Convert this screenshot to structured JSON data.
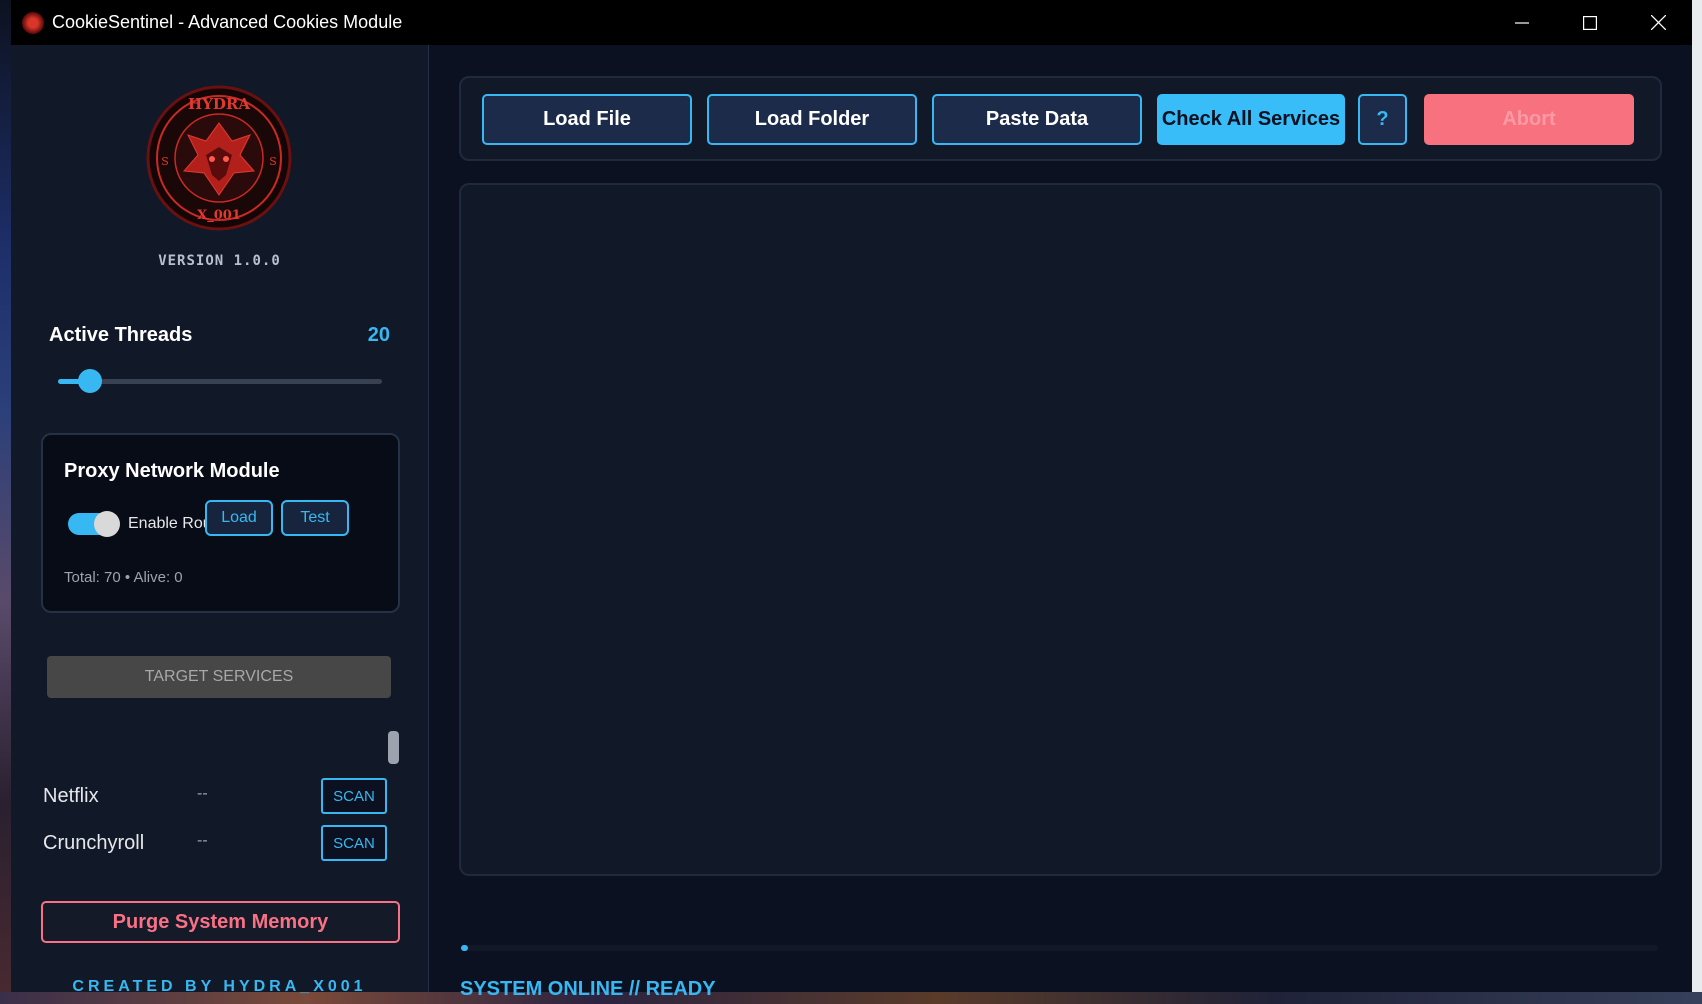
{
  "window": {
    "title": "CookieSentinel - Advanced Cookies Module"
  },
  "sidebar": {
    "logo": {
      "top_text": "HYDRA",
      "bottom_text": "X_001",
      "side_letter": "S"
    },
    "version": "VERSION 1.0.0",
    "threads": {
      "label": "Active Threads",
      "value": "20",
      "slider_fraction": 0.1
    },
    "proxy": {
      "title": "Proxy Network Module",
      "toggle_label": "Enable Route",
      "toggle_on": true,
      "load_label": "Load",
      "test_label": "Test",
      "stats": "Total: 70  •  Alive: 0"
    },
    "services": {
      "header": "TARGET SERVICES",
      "items": [
        {
          "name": "Netflix",
          "status": "--",
          "action": "SCAN"
        },
        {
          "name": "Crunchyroll",
          "status": "--",
          "action": "SCAN"
        }
      ]
    },
    "purge_label": "Purge System Memory",
    "credit": "CREATED BY HYDRA_X001"
  },
  "toolbar": {
    "load_file": "Load File",
    "load_folder": "Load Folder",
    "paste_data": "Paste Data",
    "check_all": "Check All Services",
    "help": "?",
    "abort": "Abort"
  },
  "progress": {
    "fraction": 0.006
  },
  "status": "SYSTEM ONLINE // READY",
  "colors": {
    "accent": "#38b8f2",
    "danger": "#f87185",
    "background": "#0b1120",
    "panel": "#111827"
  }
}
